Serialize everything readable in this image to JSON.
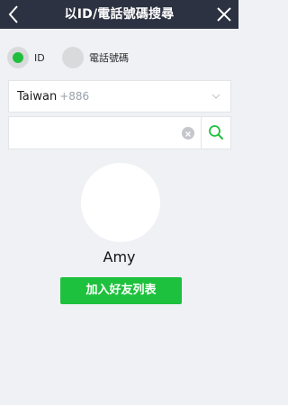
{
  "header": {
    "title": "以ID/電話號碼搜尋",
    "back_icon": "chevron-left-icon",
    "close_icon": "close-icon"
  },
  "search_type": {
    "options": [
      {
        "label": "ID",
        "selected": true
      },
      {
        "label": "電話號碼",
        "selected": false
      }
    ]
  },
  "country": {
    "name": "Taiwan",
    "code": "+886",
    "chevron_icon": "chevron-down-icon"
  },
  "search": {
    "value": "",
    "placeholder": "",
    "clear_icon": "clear-icon",
    "search_icon": "search-icon"
  },
  "result": {
    "name": "Amy",
    "add_button_label": "加入好友列表"
  },
  "colors": {
    "nav_background": "#2d3242",
    "page_background": "#f0f1f5",
    "accent_green": "#1ec13d",
    "radio_inactive": "#d9dadc",
    "secondary_text": "#9aa0a8"
  }
}
